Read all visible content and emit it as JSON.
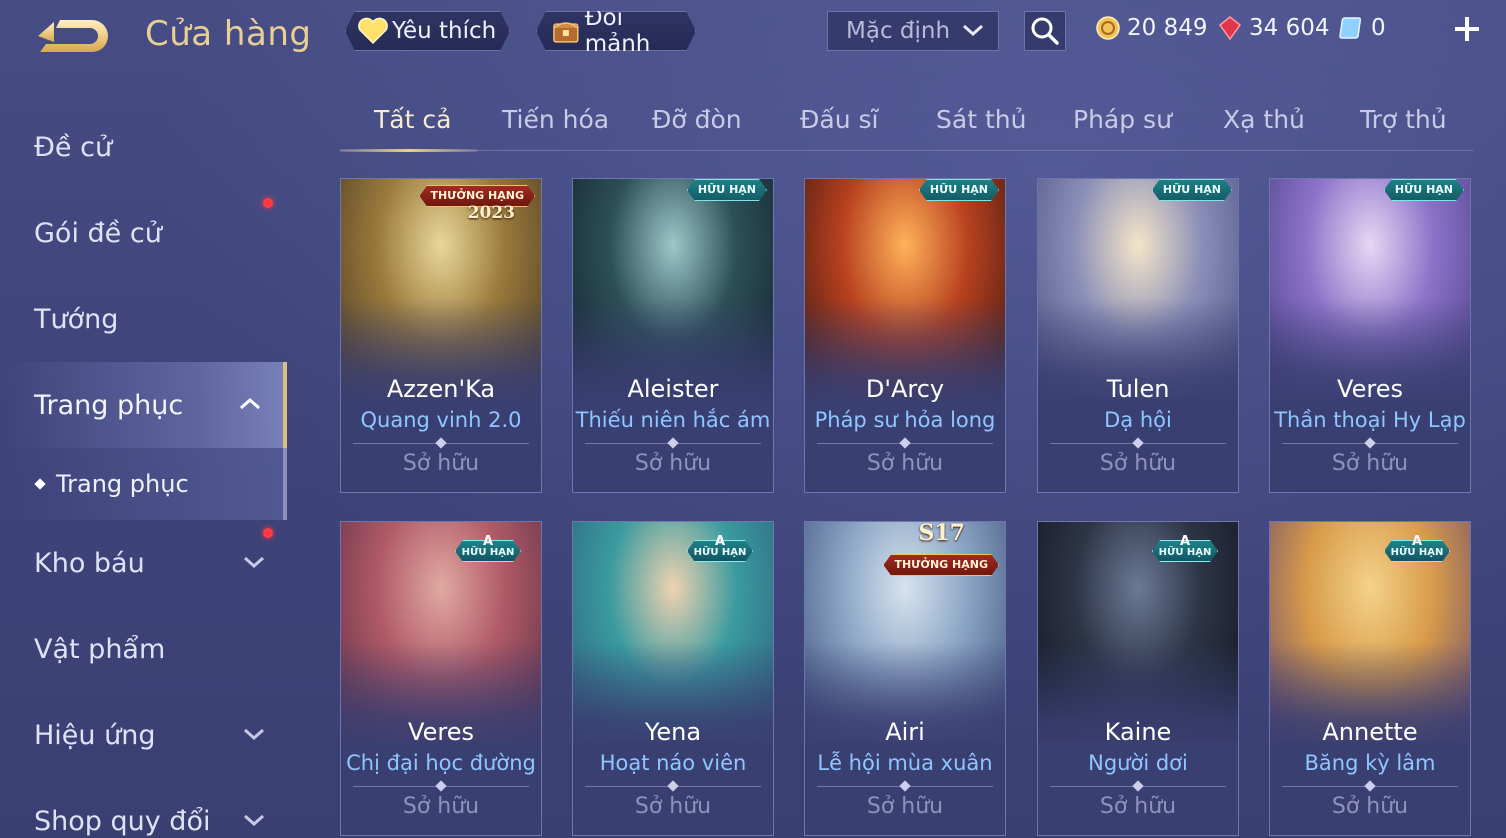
{
  "header": {
    "title": "Cửa hàng",
    "favorites_label": "Yêu thích",
    "exchange_label": "Đổi mảnh",
    "sort_selected": "Mặc định"
  },
  "currency": {
    "gold": "20 849",
    "ruby": "34 604",
    "voucher": "0"
  },
  "sidebar": {
    "items": [
      {
        "label": "Đề cử"
      },
      {
        "label": "Gói đề cử"
      },
      {
        "label": "Tướng"
      },
      {
        "label": "Trang phục"
      },
      {
        "label": "Kho báu"
      },
      {
        "label": "Vật phẩm"
      },
      {
        "label": "Hiệu ứng"
      },
      {
        "label": "Shop quy đổi"
      }
    ],
    "subitem": "Trang phục"
  },
  "tabs": [
    "Tất cả",
    "Tiến hóa",
    "Đỡ đòn",
    "Đấu sĩ",
    "Sát thủ",
    "Pháp sư",
    "Xạ thủ",
    "Trợ thủ"
  ],
  "cards": [
    {
      "hero": "Azzen'Ka",
      "skin": "Quang vinh 2.0",
      "status": "Sở hữu",
      "badge": "THƯỞNG HẠNG",
      "badge_extra": "2023",
      "art": [
        "#e9d79a",
        "#9a7a3c",
        "#4a3a22"
      ]
    },
    {
      "hero": "Aleister",
      "skin": "Thiếu niên hắc ám",
      "status": "Sở hữu",
      "badge": "HỮU HẠN",
      "art": [
        "#9dc7c9",
        "#2d4f57",
        "#12212c"
      ]
    },
    {
      "hero": "D'Arcy",
      "skin": "Pháp sư hỏa long",
      "status": "Sở hữu",
      "badge": "HỮU HẠN",
      "art": [
        "#ffb25a",
        "#b8411f",
        "#3a1610"
      ]
    },
    {
      "hero": "Tulen",
      "skin": "Dạ hội",
      "status": "Sở hữu",
      "badge": "HỮU HẠN",
      "art": [
        "#f4e5c8",
        "#8b8fb8",
        "#4a4f80"
      ]
    },
    {
      "hero": "Veres",
      "skin": "Thần thoại Hy Lạp",
      "status": "Sở hữu",
      "badge": "HỮU HẠN",
      "art": [
        "#e6d8f4",
        "#8c73c9",
        "#4a3f86"
      ]
    },
    {
      "hero": "Veres",
      "skin": "Chị đại học đường",
      "status": "Sở hữu",
      "badge_letter": "A",
      "badge": "HỮU HẠN",
      "art": [
        "#e0a9a2",
        "#b05a66",
        "#5c2f48"
      ]
    },
    {
      "hero": "Yena",
      "skin": "Hoạt náo viên",
      "status": "Sở hữu",
      "badge_letter": "A",
      "badge": "HỮU HẠN",
      "art": [
        "#f0d2b0",
        "#3a9ba0",
        "#2e5f7a"
      ]
    },
    {
      "hero": "Airi",
      "skin": "Lễ hội mùa xuân",
      "status": "Sở hữu",
      "badge": "THƯỞNG HẠNG",
      "badge_extra": "S17",
      "art": [
        "#d7e3ef",
        "#8aa5c4",
        "#3d4f7a"
      ]
    },
    {
      "hero": "Kaine",
      "skin": "Người dơi",
      "status": "Sở hữu",
      "badge_letter": "A",
      "badge": "HỮU HẠN",
      "art": [
        "#6b7a96",
        "#2d3446",
        "#111520"
      ]
    },
    {
      "hero": "Annette",
      "skin": "Băng kỳ lâm",
      "status": "Sở hữu",
      "badge_letter": "A",
      "badge": "HỮU HẠN",
      "art": [
        "#f4d28a",
        "#d89b4a",
        "#6b4a6f"
      ]
    }
  ],
  "colors": {
    "accent_gold": "#e8cf93",
    "skin_name": "#8fc6ff",
    "background": "#3f4579",
    "notification": "#ff3b46"
  },
  "icons": {
    "back": "back-arrow-icon",
    "favorites": "heart-icon",
    "exchange": "chest-icon",
    "search": "search-icon",
    "gold": "gold-coin-icon",
    "ruby": "ruby-gem-icon",
    "voucher": "voucher-icon",
    "add": "plus-icon"
  }
}
